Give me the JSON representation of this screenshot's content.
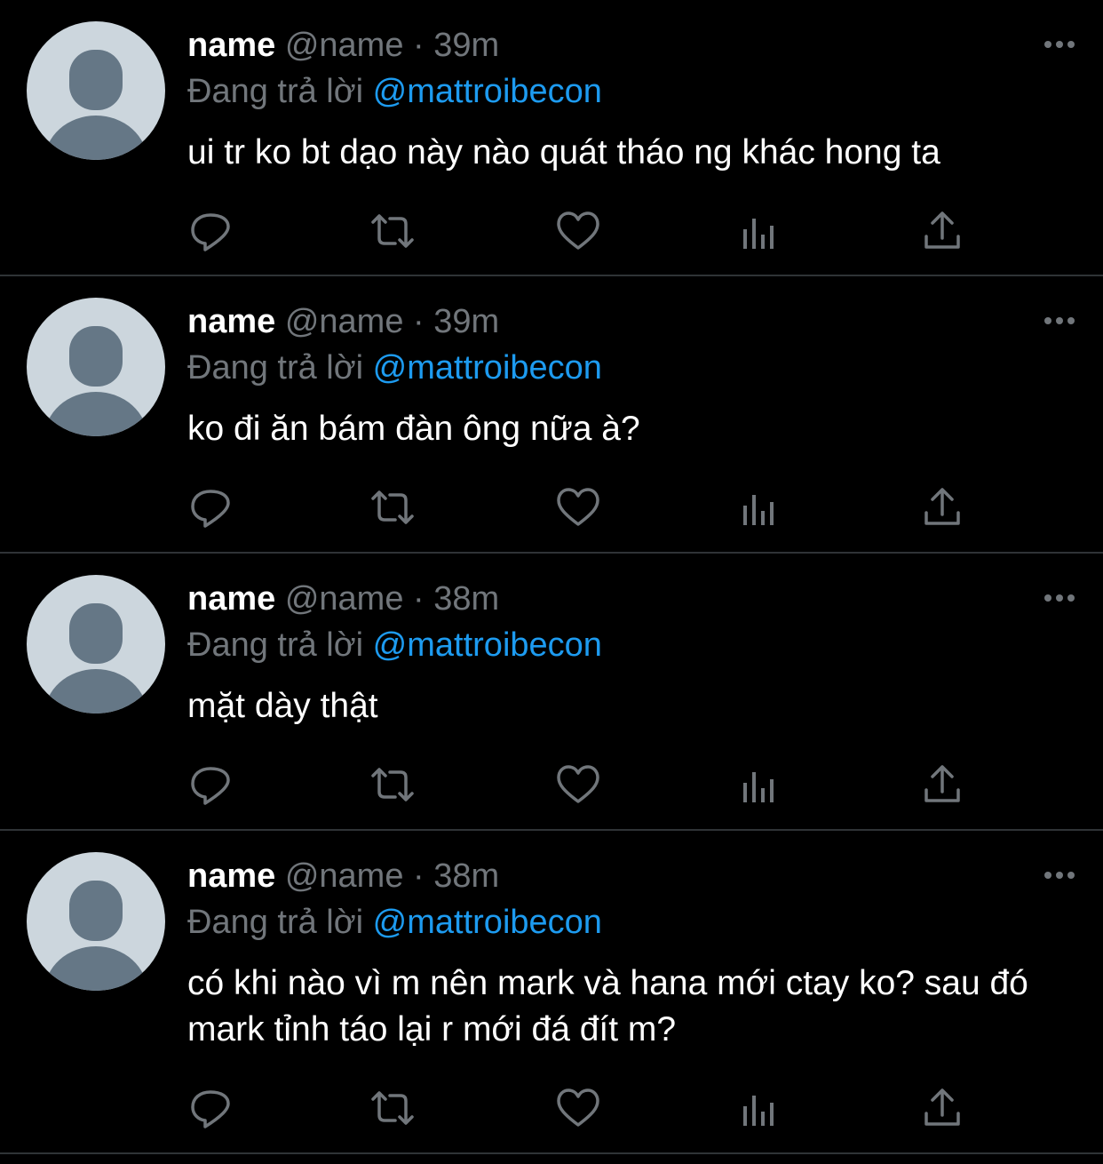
{
  "colors": {
    "background": "#000000",
    "divider": "#2f3336",
    "secondary_text": "#71767b",
    "mention": "#1d9bf0",
    "avatar_bg": "#ccd6dd",
    "avatar_fg": "#657786"
  },
  "icons": {
    "more": "more-horizontal-icon",
    "reply": "reply-icon",
    "retweet": "retweet-icon",
    "like": "heart-icon",
    "views": "views-icon",
    "share": "share-icon"
  },
  "tweets": [
    {
      "name": "name",
      "handle": "@name",
      "separator": "·",
      "time": "39m",
      "reply_prefix": "Đang trả lời",
      "reply_to": "@mattroibecon",
      "text": "ui tr ko bt dạo này nào quát tháo ng khác hong ta"
    },
    {
      "name": "name",
      "handle": "@name",
      "separator": "·",
      "time": "39m",
      "reply_prefix": "Đang trả lời",
      "reply_to": "@mattroibecon",
      "text": "ko đi ăn bám đàn ông nữa à?"
    },
    {
      "name": "name",
      "handle": "@name",
      "separator": "·",
      "time": "38m",
      "reply_prefix": "Đang trả lời",
      "reply_to": "@mattroibecon",
      "text": "mặt dày thật"
    },
    {
      "name": "name",
      "handle": "@name",
      "separator": "·",
      "time": "38m",
      "reply_prefix": "Đang trả lời",
      "reply_to": "@mattroibecon",
      "text": "có khi nào vì m nên mark và hana mới ctay ko? sau đó mark tỉnh táo lại r mới đá đít m?"
    }
  ]
}
